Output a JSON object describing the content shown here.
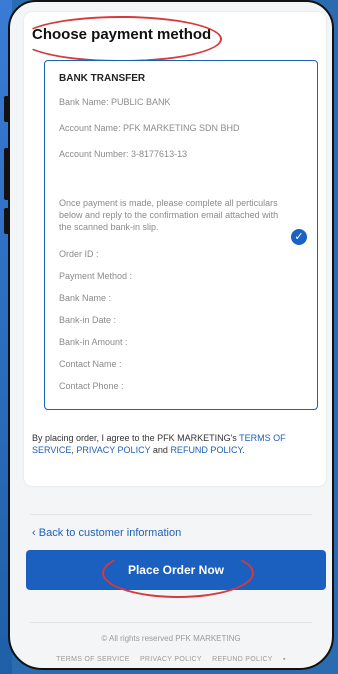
{
  "card": {
    "title": "Choose payment method"
  },
  "bank": {
    "heading": "BANK TRANSFER",
    "name": "Bank Name: PUBLIC BANK",
    "account_name": "Account Name: PFK MARKETING SDN BHD",
    "account_number": "Account Number: 3-8177613-13",
    "instructions": "Once payment is made, please complete all perticulars below and reply to the confirmation email attached with the scanned bank-in slip.",
    "fields": [
      "Order ID :",
      "Payment Method :",
      "Bank Name :",
      "Bank-in Date :",
      "Bank-in Amount :",
      "Contact Name :",
      "Contact Phone :"
    ]
  },
  "legal": {
    "prefix": "By placing order, I agree to the PFK MARKETING's ",
    "terms": "TERMS OF SERVICE",
    "comma": ", ",
    "privacy": "PRIVACY POLICY",
    "and": " and ",
    "refund": "REFUND POLICY",
    "suffix": "."
  },
  "nav": {
    "back": "Back to customer information",
    "place": "Place Order Now"
  },
  "footer": {
    "copyright": "© All rights reserved PFK MARKETING",
    "links": [
      "TERMS OF SERVICE",
      "PRIVACY POLICY",
      "REFUND POLICY"
    ]
  },
  "colors": {
    "accent": "#1b5fbf",
    "annotation": "#d63a3a"
  }
}
